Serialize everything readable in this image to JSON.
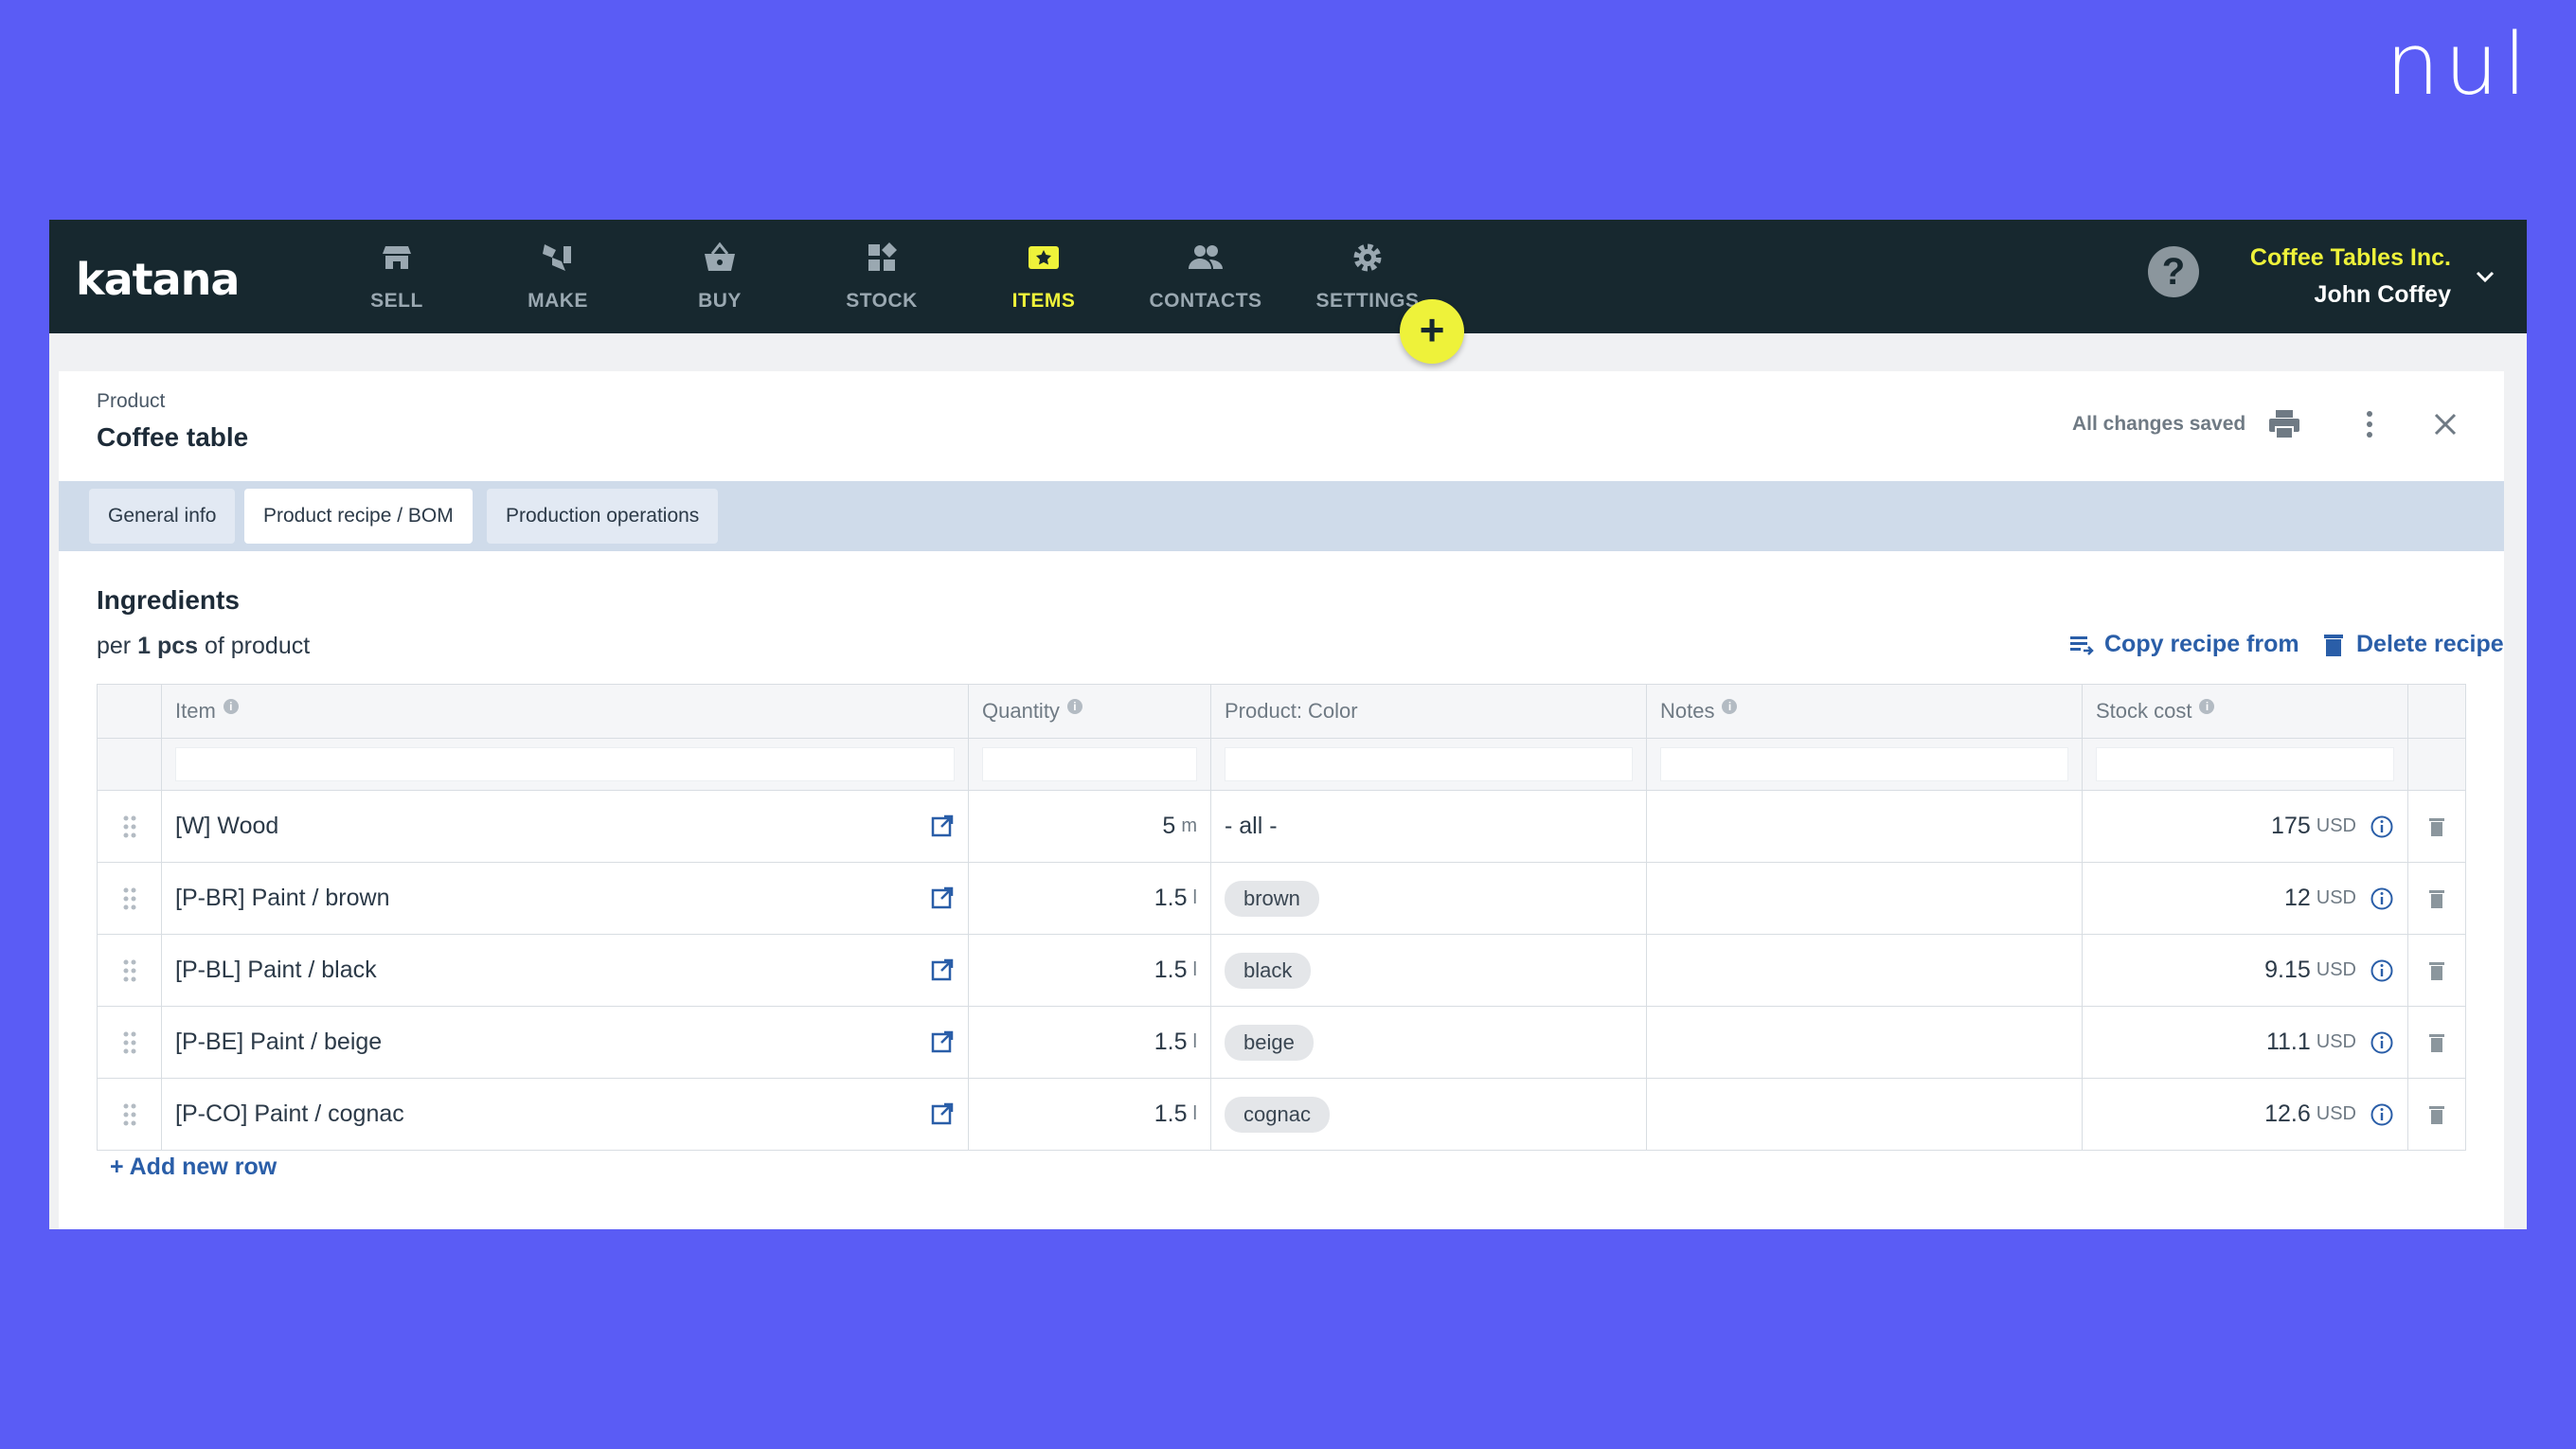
{
  "watermark": "nul",
  "app": {
    "logo": "katana",
    "nav": [
      {
        "label": "SELL",
        "icon": "shop-icon"
      },
      {
        "label": "MAKE",
        "icon": "make-icon"
      },
      {
        "label": "BUY",
        "icon": "basket-icon"
      },
      {
        "label": "STOCK",
        "icon": "boxes-icon"
      },
      {
        "label": "ITEMS",
        "icon": "items-icon",
        "active": true
      },
      {
        "label": "CONTACTS",
        "icon": "people-icon"
      },
      {
        "label": "SETTINGS",
        "icon": "gear-icon"
      }
    ],
    "help": "?",
    "add_button": "+",
    "account": {
      "company": "Coffee Tables Inc.",
      "user": "John Coffey"
    },
    "colors": {
      "nav_bg": "#17282f",
      "accent": "#eef23a",
      "link": "#2a5ea8",
      "background": "#5a5cf5"
    }
  },
  "product": {
    "type_label": "Product",
    "name": "Coffee table",
    "save_status": "All changes saved"
  },
  "tabs": [
    {
      "label": "General info"
    },
    {
      "label": "Product recipe / BOM",
      "active": true
    },
    {
      "label": "Production operations"
    }
  ],
  "ingredients": {
    "title": "Ingredients",
    "per_prefix": "per",
    "per_qty": "1 pcs",
    "per_suffix": "of product",
    "copy_recipe": "Copy recipe from",
    "delete_recipe": "Delete recipe",
    "columns": {
      "item": "Item",
      "quantity": "Quantity",
      "color": "Product: Color",
      "notes": "Notes",
      "stock_cost": "Stock cost"
    },
    "rows": [
      {
        "item": "[W] Wood",
        "qty": "5",
        "unit": "m",
        "color": "- all -",
        "color_chip": false,
        "notes": "",
        "cost": "175",
        "currency": "USD"
      },
      {
        "item": "[P-BR] Paint / brown",
        "qty": "1.5",
        "unit": "l",
        "color": "brown",
        "color_chip": true,
        "notes": "",
        "cost": "12",
        "currency": "USD"
      },
      {
        "item": "[P-BL] Paint / black",
        "qty": "1.5",
        "unit": "l",
        "color": "black",
        "color_chip": true,
        "notes": "",
        "cost": "9.15",
        "currency": "USD"
      },
      {
        "item": "[P-BE] Paint / beige",
        "qty": "1.5",
        "unit": "l",
        "color": "beige",
        "color_chip": true,
        "notes": "",
        "cost": "11.1",
        "currency": "USD"
      },
      {
        "item": "[P-CO] Paint / cognac",
        "qty": "1.5",
        "unit": "l",
        "color": "cognac",
        "color_chip": true,
        "notes": "",
        "cost": "12.6",
        "currency": "USD"
      }
    ],
    "add_row": "+ Add new row"
  }
}
